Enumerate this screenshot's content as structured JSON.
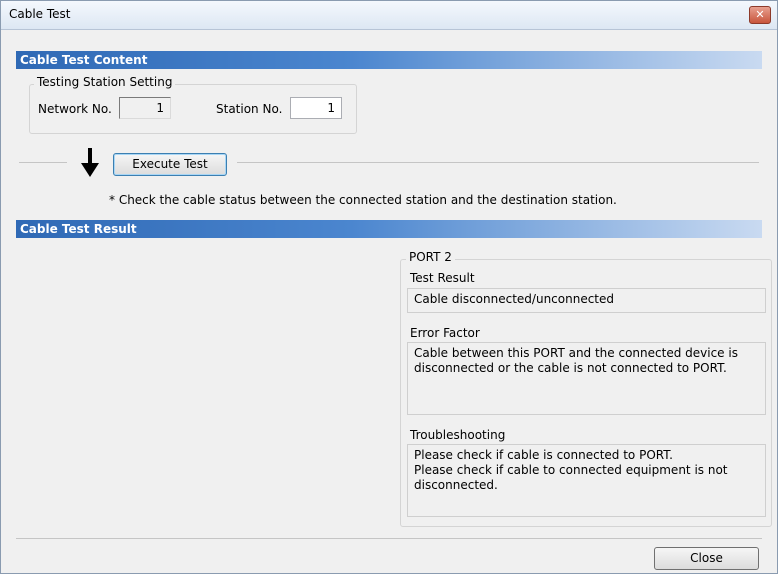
{
  "window": {
    "title": "Cable Test",
    "close_glyph": "✕"
  },
  "content_section": {
    "header": "Cable Test Content",
    "testing_station": {
      "legend": "Testing Station Setting",
      "network_label": "Network No.",
      "network_value": "1",
      "station_label": "Station No.",
      "station_value": "1"
    },
    "execute_button": "Execute Test",
    "note": "* Check the cable status between the connected station and the destination station."
  },
  "result_section": {
    "header": "Cable Test Result",
    "port": {
      "legend": "PORT 2",
      "test_result_label": "Test Result",
      "test_result_value": "Cable disconnected/unconnected",
      "error_factor_label": "Error Factor",
      "error_factor_value": "Cable between this PORT and the connected device is\ndisconnected or the cable is not connected to PORT.",
      "troubleshooting_label": "Troubleshooting",
      "troubleshooting_value": "Please check if cable is connected to PORT.\nPlease check if cable to connected equipment is not\ndisconnected."
    }
  },
  "footer": {
    "close_button": "Close"
  },
  "icons": {
    "arrow": "down-arrow-icon",
    "close": "close-icon"
  },
  "colors": {
    "header_dark": "#2f69b5",
    "header_light": "#c9daf1",
    "close_red": "#c8553c"
  }
}
